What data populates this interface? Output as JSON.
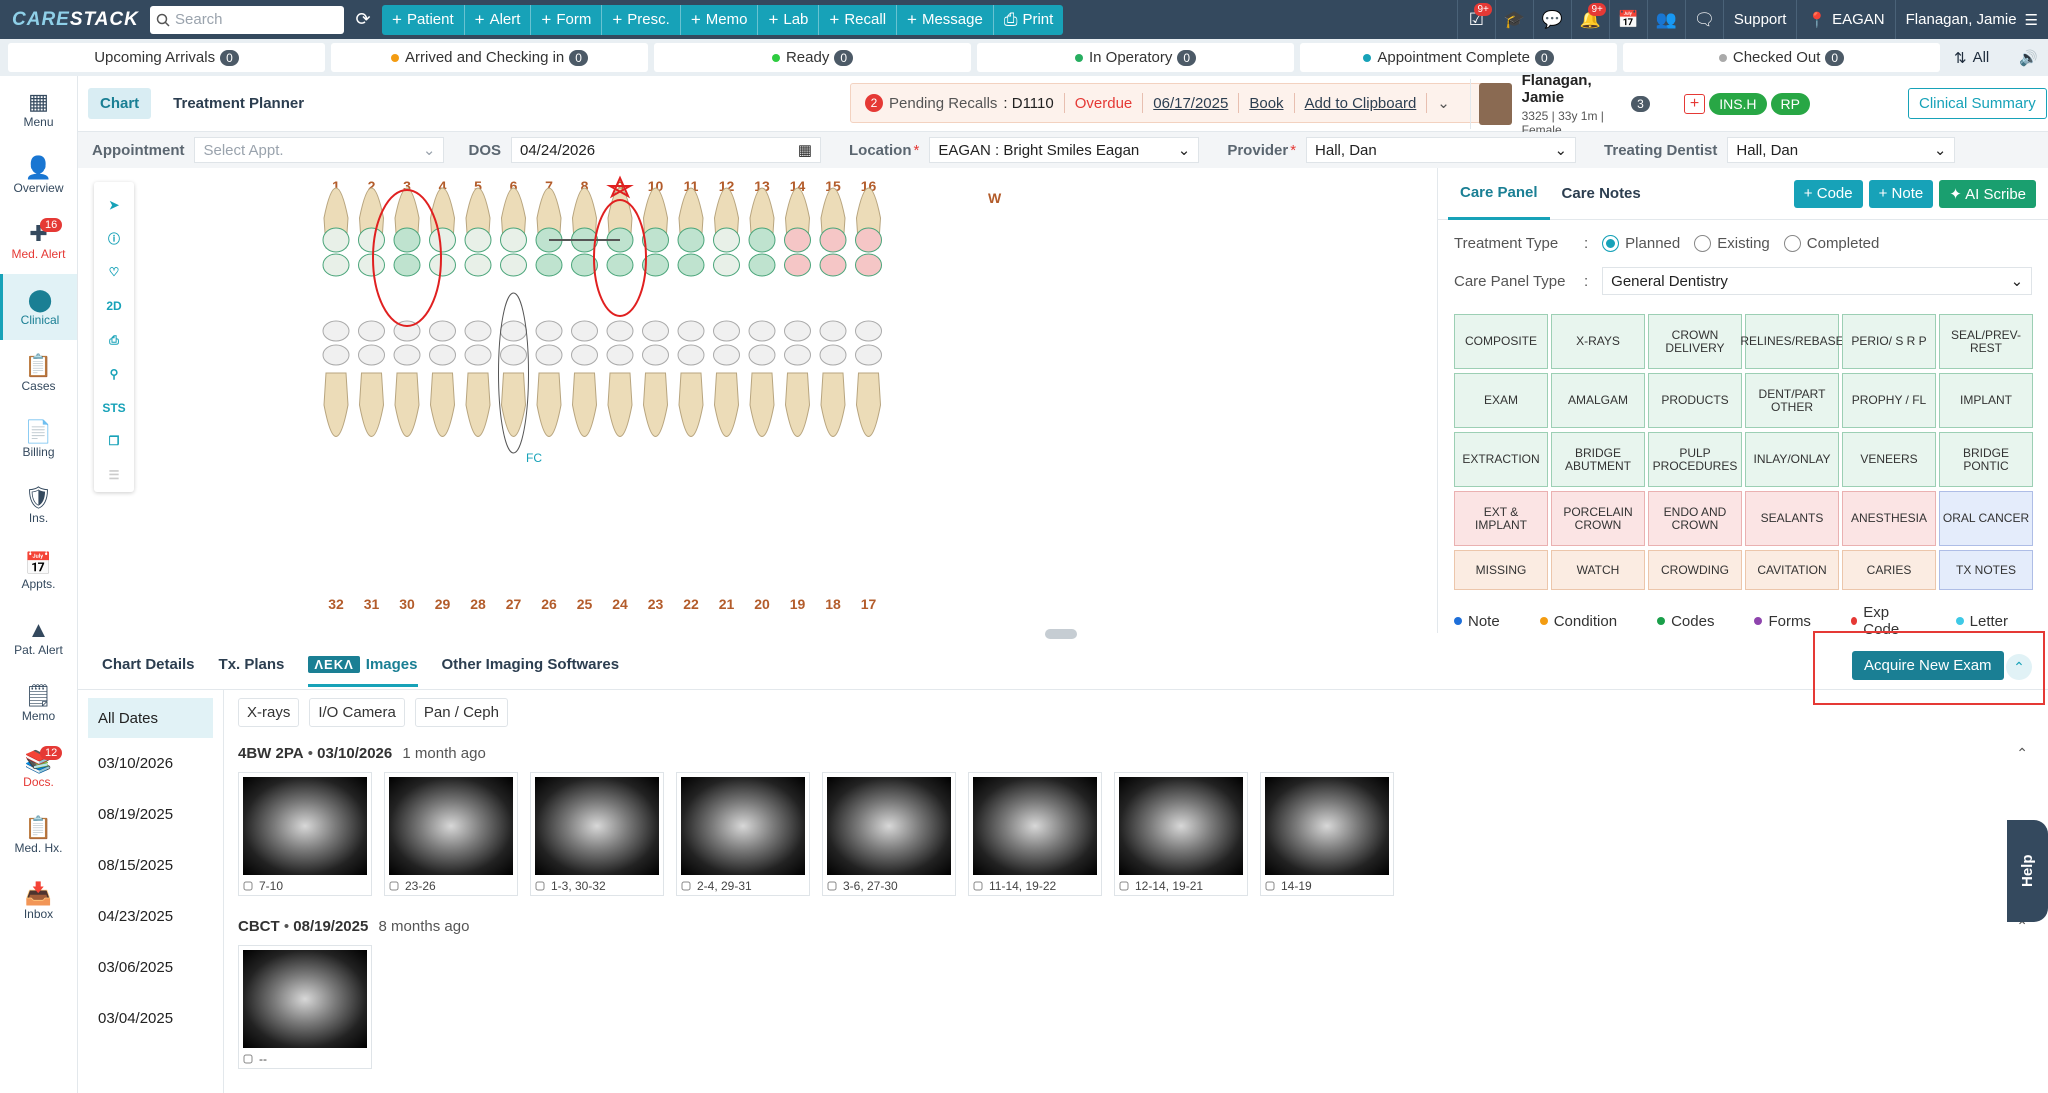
{
  "topbar": {
    "logo_a": "CARE",
    "logo_b": "STACK",
    "search_placeholder": "Search",
    "quick_actions": [
      {
        "label": "Patient"
      },
      {
        "label": "Alert"
      },
      {
        "label": "Form"
      },
      {
        "label": "Presc."
      },
      {
        "label": "Memo"
      },
      {
        "label": "Lab"
      },
      {
        "label": "Recall"
      },
      {
        "label": "Message"
      },
      {
        "label": "Print"
      }
    ],
    "badge_a": "9+",
    "badge_b": "9+",
    "support": "Support",
    "location": "EAGAN",
    "user": "Flanagan, Jamie"
  },
  "status": {
    "tabs": [
      {
        "label": "Upcoming Arrivals",
        "count": "0",
        "color": ""
      },
      {
        "label": "Arrived and Checking in",
        "count": "0",
        "color": "#f39c12"
      },
      {
        "label": "Ready",
        "count": "0",
        "color": "#2ecc40"
      },
      {
        "label": "In Operatory",
        "count": "0",
        "color": "#27ae60"
      },
      {
        "label": "Appointment Complete",
        "count": "0",
        "color": "#17a2b8"
      },
      {
        "label": "Checked Out",
        "count": "0",
        "color": "#aaaaaa"
      }
    ],
    "all": "All"
  },
  "sidebar": {
    "items": [
      {
        "label": "Menu"
      },
      {
        "label": "Overview"
      },
      {
        "label": "Med. Alert",
        "badge": "16"
      },
      {
        "label": "Clinical"
      },
      {
        "label": "Cases"
      },
      {
        "label": "Billing"
      },
      {
        "label": "Ins."
      },
      {
        "label": "Appts."
      },
      {
        "label": "Pat. Alert"
      },
      {
        "label": "Memo"
      },
      {
        "label": "Docs.",
        "badge": "12"
      },
      {
        "label": "Med. Hx."
      },
      {
        "label": "Inbox"
      }
    ]
  },
  "header": {
    "tab_chart": "Chart",
    "tab_planner": "Treatment Planner",
    "recall_count": "2",
    "recall_label": "Pending Recalls",
    "recall_code": ": D1110",
    "recall_status": "Overdue",
    "recall_date": "06/17/2025",
    "book": "Book",
    "clipboard": "Add to Clipboard",
    "patient_name": "Flanagan, Jamie",
    "patient_id": "3325",
    "patient_age": "33y 1m",
    "patient_sex": "Female",
    "patient_count": "3",
    "ins_h": "INS.H",
    "rp": "RP",
    "clinical_summary": "Clinical Summary"
  },
  "filters": {
    "appointment_label": "Appointment",
    "appointment_ph": "Select Appt.",
    "dos_label": "DOS",
    "dos_value": "04/24/2026",
    "location_label": "Location",
    "location_value": "EAGAN : Bright Smiles Eagan",
    "provider_label": "Provider",
    "provider_value": "Hall, Dan",
    "treating_label": "Treating Dentist",
    "treating_value": "Hall, Dan"
  },
  "chart": {
    "tools": [
      "2D",
      "STS"
    ],
    "upper_numbers": [
      "1",
      "2",
      "3",
      "4",
      "5",
      "6",
      "7",
      "8",
      "9",
      "10",
      "11",
      "12",
      "13",
      "14",
      "15",
      "16"
    ],
    "lower_numbers": [
      "32",
      "31",
      "30",
      "29",
      "28",
      "27",
      "26",
      "25",
      "24",
      "23",
      "22",
      "21",
      "20",
      "19",
      "18",
      "17"
    ],
    "tooth13_mark": "W",
    "fc_mark": "FC"
  },
  "care": {
    "tab_panel": "Care Panel",
    "tab_notes": "Care Notes",
    "code_btn": "Code",
    "note_btn": "Note",
    "scribe_btn": "AI Scribe",
    "tx_type_label": "Treatment Type",
    "tx_planned": "Planned",
    "tx_existing": "Existing",
    "tx_completed": "Completed",
    "panel_type_label": "Care Panel Type",
    "panel_type_value": "General Dentistry",
    "buttons": [
      {
        "label": "COMPOSITE",
        "c": ""
      },
      {
        "label": "X-RAYS",
        "c": ""
      },
      {
        "label": "CROWN DELIVERY",
        "c": ""
      },
      {
        "label": "RELINES/REBASE",
        "c": ""
      },
      {
        "label": "PERIO/ S R P",
        "c": ""
      },
      {
        "label": "SEAL/PREV-REST",
        "c": ""
      },
      {
        "label": "EXAM",
        "c": ""
      },
      {
        "label": "AMALGAM",
        "c": ""
      },
      {
        "label": "PRODUCTS",
        "c": ""
      },
      {
        "label": "DENT/PART OTHER",
        "c": ""
      },
      {
        "label": "PROPHY / FL",
        "c": ""
      },
      {
        "label": "IMPLANT",
        "c": ""
      },
      {
        "label": "EXTRACTION",
        "c": ""
      },
      {
        "label": "BRIDGE ABUTMENT",
        "c": ""
      },
      {
        "label": "PULP PROCEDURES",
        "c": ""
      },
      {
        "label": "INLAY/ONLAY",
        "c": ""
      },
      {
        "label": "VENEERS",
        "c": ""
      },
      {
        "label": "BRIDGE PONTIC",
        "c": ""
      },
      {
        "label": "EXT & IMPLANT",
        "c": "r"
      },
      {
        "label": "PORCELAIN CROWN",
        "c": "r"
      },
      {
        "label": "ENDO AND CROWN",
        "c": "r"
      },
      {
        "label": "SEALANTS",
        "c": "r"
      },
      {
        "label": "ANESTHESIA",
        "c": "r"
      },
      {
        "label": "ORAL CANCER",
        "c": "b"
      },
      {
        "label": "MISSING",
        "c": "o"
      },
      {
        "label": "WATCH",
        "c": "o"
      },
      {
        "label": "CROWDING",
        "c": "o"
      },
      {
        "label": "CAVITATION",
        "c": "o"
      },
      {
        "label": "CARIES",
        "c": "o"
      },
      {
        "label": "TX NOTES",
        "c": "o2"
      }
    ],
    "legend": [
      {
        "label": "Note",
        "color": "#1e6fd9"
      },
      {
        "label": "Condition",
        "color": "#f39c12"
      },
      {
        "label": "Codes",
        "color": "#1a9f4a"
      },
      {
        "label": "Forms",
        "color": "#8e44ad"
      },
      {
        "label": "Exp Code",
        "color": "#e53935"
      },
      {
        "label": "Letter",
        "color": "#3ec9e6"
      }
    ]
  },
  "bottom": {
    "tab_details": "Chart Details",
    "tab_plans": "Tx. Plans",
    "aeka": "ΛEKΛ",
    "tab_images": "Images",
    "tab_other": "Other Imaging Softwares",
    "acquire": "Acquire New Exam",
    "dates": [
      "All Dates",
      "03/10/2026",
      "08/19/2025",
      "08/15/2025",
      "04/23/2025",
      "03/06/2025",
      "03/04/2025"
    ],
    "filters": [
      "X-rays",
      "I/O Camera",
      "Pan / Ceph"
    ],
    "group1": {
      "type": "4BW 2PA",
      "date": "03/10/2026",
      "ago": "1 month ago"
    },
    "group1_images": [
      "7-10",
      "23-26",
      "1-3, 30-32",
      "2-4, 29-31",
      "3-6, 27-30",
      "11-14, 19-22",
      "12-14, 19-21",
      "14-19"
    ],
    "group2": {
      "type": "CBCT",
      "date": "08/19/2025",
      "ago": "8 months ago"
    },
    "group2_images": [
      "--"
    ],
    "help": "Help"
  }
}
